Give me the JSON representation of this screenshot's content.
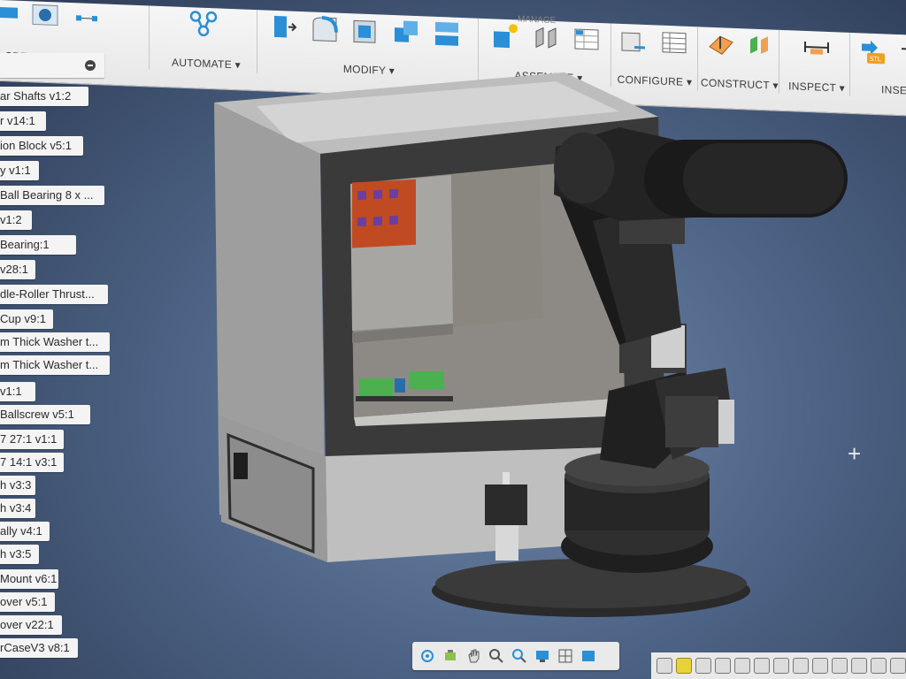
{
  "toolbar": {
    "create_label": "CREATE ▾",
    "automate_label": "AUTOMATE ▾",
    "modify_label": "MODIFY ▾",
    "manage_label": "MANAGE",
    "assemble_label": "ASSEMBLE ▾",
    "configure_label": "CONFIGURE ▾",
    "construct_label": "CONSTRUCT ▾",
    "inspect_label": "INSPECT ▾",
    "insert_label": "INSE"
  },
  "browser": {
    "items": [
      {
        "label": "ar Shafts v1:2"
      },
      {
        "label": "r v14:1"
      },
      {
        "label": "ion Block v5:1"
      },
      {
        "label": "y v1:1"
      },
      {
        "label": "Ball Bearing 8 x ..."
      },
      {
        "label": "v1:2"
      },
      {
        "label": " Bearing:1"
      },
      {
        "label": "v28:1"
      },
      {
        "label": "dle-Roller Thrust..."
      },
      {
        "label": "Cup v9:1"
      },
      {
        "label": "m Thick Washer t..."
      },
      {
        "label": "m Thick Washer t..."
      },
      {
        "label": " v1:1"
      },
      {
        "label": " Ballscrew v5:1"
      },
      {
        "label": "7 27:1 v1:1"
      },
      {
        "label": "7 14:1 v3:1"
      },
      {
        "label": "h v3:3"
      },
      {
        "label": "h v3:4"
      },
      {
        "label": "ally v4:1"
      },
      {
        "label": "h v3:5"
      },
      {
        "label": "Mount v6:1"
      },
      {
        "label": "over v5:1"
      },
      {
        "label": "over v22:1"
      },
      {
        "label": "rCaseV3 v8:1"
      }
    ]
  },
  "colors": {
    "viewport_bg": "#4e6486",
    "toolbar_bg": "#eeeeee",
    "accent_blue": "#2a8fd6"
  }
}
